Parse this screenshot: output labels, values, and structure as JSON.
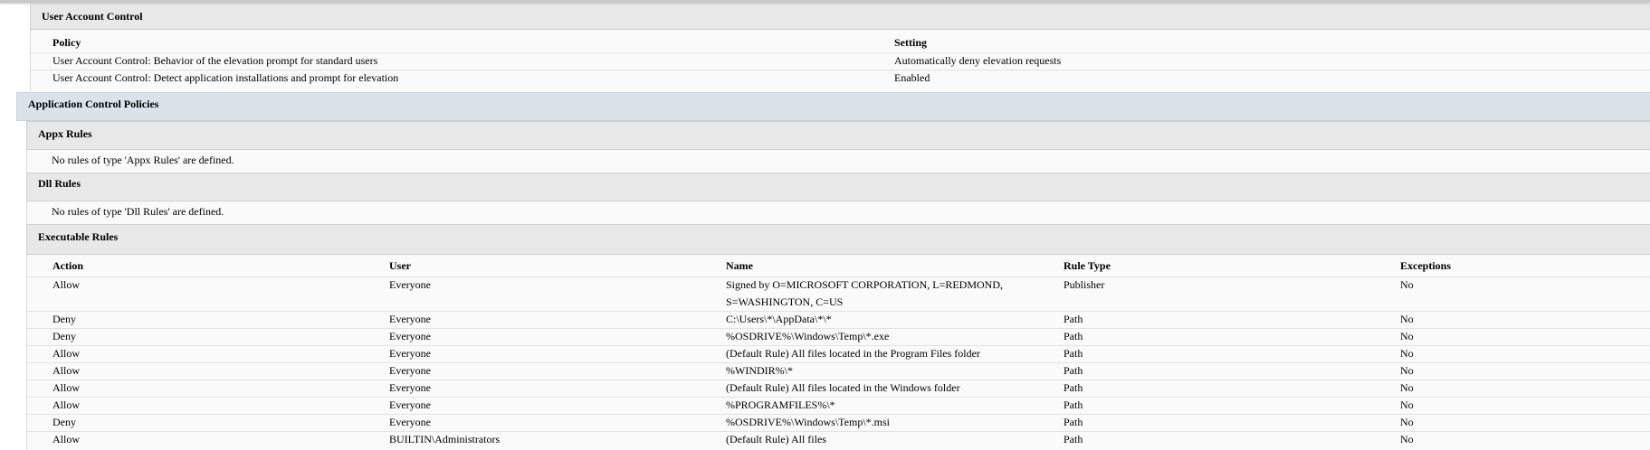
{
  "uac": {
    "title": "User Account Control",
    "headers": {
      "policy": "Policy",
      "setting": "Setting"
    },
    "rows": [
      {
        "policy": "User Account Control: Behavior of the elevation prompt for standard users",
        "setting": "Automatically deny elevation requests"
      },
      {
        "policy": "User Account Control: Detect application installations and prompt for elevation",
        "setting": "Enabled"
      }
    ]
  },
  "app_control": {
    "title": "Application Control Policies"
  },
  "appx": {
    "title": "Appx Rules",
    "message": "No rules of type 'Appx Rules' are defined."
  },
  "dll": {
    "title": "Dll Rules",
    "message": "No rules of type 'Dll Rules' are defined."
  },
  "exe": {
    "title": "Executable Rules",
    "headers": {
      "action": "Action",
      "user": "User",
      "name": "Name",
      "rule_type": "Rule Type",
      "exceptions": "Exceptions"
    },
    "rows": [
      {
        "action": "Allow",
        "user": "Everyone",
        "name": "Signed by O=MICROSOFT CORPORATION, L=REDMOND, S=WASHINGTON, C=US",
        "rule_type": "Publisher",
        "exceptions": "No"
      },
      {
        "action": "Deny",
        "user": "Everyone",
        "name": "C:\\Users\\*\\AppData\\*\\*",
        "rule_type": "Path",
        "exceptions": "No"
      },
      {
        "action": "Deny",
        "user": "Everyone",
        "name": "%OSDRIVE%\\Windows\\Temp\\*.exe",
        "rule_type": "Path",
        "exceptions": "No"
      },
      {
        "action": "Allow",
        "user": "Everyone",
        "name": "(Default Rule) All files located in the Program Files folder",
        "rule_type": "Path",
        "exceptions": "No"
      },
      {
        "action": "Allow",
        "user": "Everyone",
        "name": "%WINDIR%\\*",
        "rule_type": "Path",
        "exceptions": "No"
      },
      {
        "action": "Allow",
        "user": "Everyone",
        "name": "(Default Rule) All files located in the Windows folder",
        "rule_type": "Path",
        "exceptions": "No"
      },
      {
        "action": "Allow",
        "user": "Everyone",
        "name": "%PROGRAMFILES%\\*",
        "rule_type": "Path",
        "exceptions": "No"
      },
      {
        "action": "Deny",
        "user": "Everyone",
        "name": "%OSDRIVE%\\Windows\\Temp\\*.msi",
        "rule_type": "Path",
        "exceptions": "No"
      },
      {
        "action": "Allow",
        "user": "BUILTIN\\Administrators",
        "name": "(Default Rule) All files",
        "rule_type": "Path",
        "exceptions": "No"
      }
    ]
  }
}
